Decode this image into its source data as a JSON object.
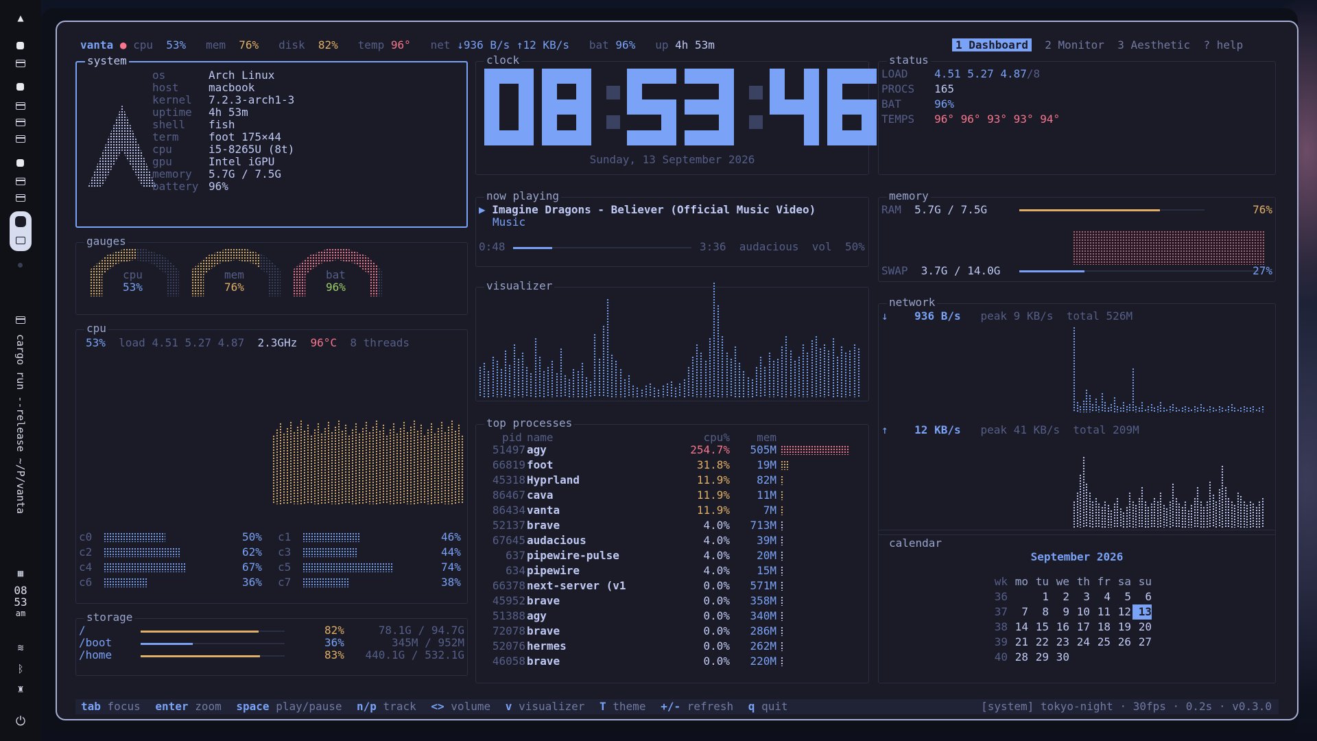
{
  "launcher": {
    "logo": "arch-logo",
    "command": "cargo run --release ~/P/vanta",
    "clock": [
      "08",
      "53",
      "am"
    ]
  },
  "topbar": {
    "host": "vanta",
    "cpu_label": "cpu",
    "cpu": "53%",
    "mem_label": "mem",
    "mem": "76%",
    "disk_label": "disk",
    "disk": "82%",
    "temp_label": "temp",
    "temp": "96°",
    "net_label": "net",
    "net": "↓936 B/s ↑12 KB/s",
    "bat_label": "bat",
    "bat": "96%",
    "up_label": "up",
    "up": "4h 53m",
    "tabs": [
      "1 Dashboard",
      "2 Monitor",
      "3 Aesthetic",
      "? help"
    ]
  },
  "system": {
    "title": "system",
    "rows": [
      [
        "os",
        "Arch Linux"
      ],
      [
        "host",
        "macbook"
      ],
      [
        "kernel",
        "7.2.3-arch1-3"
      ],
      [
        "uptime",
        "4h 53m"
      ],
      [
        "shell",
        "fish"
      ],
      [
        "term",
        "foot 175×44"
      ],
      [
        "cpu",
        "i5-8265U (8t)"
      ],
      [
        "gpu",
        "Intel iGPU"
      ],
      [
        "memory",
        "5.7G / 7.5G"
      ],
      [
        "battery",
        "96%"
      ]
    ]
  },
  "gauges": {
    "title": "gauges",
    "items": [
      {
        "label": "cpu",
        "value": "53%",
        "pct": 0.53,
        "color": "#e0af68"
      },
      {
        "label": "mem",
        "value": "76%",
        "pct": 0.76,
        "color": "#e0af68"
      },
      {
        "label": "bat",
        "value": "96%",
        "pct": 0.96,
        "color": "#f7768e"
      }
    ]
  },
  "cpu": {
    "title": "cpu",
    "pct": "53%",
    "load": "load 4.51 5.27 4.87",
    "freq": "2.3GHz",
    "temp": "96°C",
    "threads": "8 threads",
    "cores": [
      {
        "name": "c0",
        "value": "50%",
        "pct": 0.5
      },
      {
        "name": "c1",
        "value": "46%",
        "pct": 0.46
      },
      {
        "name": "c2",
        "value": "62%",
        "pct": 0.62
      },
      {
        "name": "c3",
        "value": "44%",
        "pct": 0.44
      },
      {
        "name": "c4",
        "value": "67%",
        "pct": 0.67
      },
      {
        "name": "c5",
        "value": "74%",
        "pct": 0.74
      },
      {
        "name": "c6",
        "value": "36%",
        "pct": 0.36
      },
      {
        "name": "c7",
        "value": "38%",
        "pct": 0.38
      }
    ]
  },
  "storage": {
    "title": "storage",
    "rows": [
      {
        "mount": "/",
        "pct": 0.82,
        "value": "82%",
        "size": "78.1G / 94.7G",
        "color": "#e0af68"
      },
      {
        "mount": "/boot",
        "pct": 0.36,
        "value": "36%",
        "size": "345M / 952M",
        "color": "#7aa2f7"
      },
      {
        "mount": "/home",
        "pct": 0.83,
        "value": "83%",
        "size": "440.1G / 532.1G",
        "color": "#e0af68"
      }
    ]
  },
  "clock": {
    "title": "clock",
    "time": "08:53:46",
    "date": "Sunday, 13 September 2026"
  },
  "nowplaying": {
    "title": "now playing",
    "track": "Imagine Dragons - Believer (Official Music Video)",
    "album": "Music",
    "elapsed": "0:48",
    "duration": "3:36",
    "progress": 0.22,
    "player": "audacious",
    "vol_label": "vol",
    "vol": "50%"
  },
  "visualizer": {
    "title": "visualizer"
  },
  "procs": {
    "title": "top processes",
    "headers": [
      "pid",
      "name",
      "cpu%",
      "mem"
    ],
    "rows": [
      [
        "51497",
        "agy",
        "254.7%",
        "505M"
      ],
      [
        "66819",
        "foot",
        "31.8%",
        "19M"
      ],
      [
        "45318",
        "Hyprland",
        "11.9%",
        "82M"
      ],
      [
        "86467",
        "cava",
        "11.9%",
        "11M"
      ],
      [
        "86434",
        "vanta",
        "11.9%",
        "7M"
      ],
      [
        "52137",
        "brave",
        "4.0%",
        "713M"
      ],
      [
        "67645",
        "audacious",
        "4.0%",
        "39M"
      ],
      [
        "637",
        "pipewire-pulse",
        "4.0%",
        "20M"
      ],
      [
        "634",
        "pipewire",
        "4.0%",
        "15M"
      ],
      [
        "66378",
        "next-server (v1",
        "0.0%",
        "571M"
      ],
      [
        "45952",
        "brave",
        "0.0%",
        "358M"
      ],
      [
        "51388",
        "agy",
        "0.0%",
        "340M"
      ],
      [
        "72078",
        "brave",
        "0.0%",
        "286M"
      ],
      [
        "52076",
        "hermes",
        "0.0%",
        "262M"
      ],
      [
        "46058",
        "brave",
        "0.0%",
        "220M"
      ]
    ]
  },
  "status": {
    "title": "status",
    "load_label": "LOAD",
    "load": "4.51 5.27 4.87",
    "load_of": "/8",
    "procs_label": "PROCS",
    "procs": "165",
    "bat_label": "BAT",
    "bat": "96%",
    "temps_label": "TEMPS",
    "temps": "96° 96° 93° 93° 94°"
  },
  "memory": {
    "title": "memory",
    "ram_label": "RAM",
    "ram": "5.7G / 7.5G",
    "ram_pct": "76%",
    "ram_frac": 0.76,
    "swap_label": "SWAP",
    "swap": "3.7G / 14.0G",
    "swap_pct": "27%",
    "swap_frac": 0.27
  },
  "network": {
    "title": "network",
    "down_arrow": "↓",
    "down": "936 B/s",
    "down_peak": "peak 9 KB/s",
    "down_total": "total 526M",
    "up_arrow": "↑",
    "up": "12 KB/s",
    "up_peak": "peak 41 KB/s",
    "up_total": "total 209M"
  },
  "calendar": {
    "title": "calendar",
    "month": "September 2026",
    "headers": [
      "wk",
      "mo",
      "tu",
      "we",
      "th",
      "fr",
      "sa",
      "su"
    ],
    "weeks": [
      [
        "36",
        "",
        "1",
        "2",
        "3",
        "4",
        "5",
        "6"
      ],
      [
        "37",
        "7",
        "8",
        "9",
        "10",
        "11",
        "12",
        "13"
      ],
      [
        "38",
        "14",
        "15",
        "16",
        "17",
        "18",
        "19",
        "20"
      ],
      [
        "39",
        "21",
        "22",
        "23",
        "24",
        "25",
        "26",
        "27"
      ],
      [
        "40",
        "28",
        "29",
        "30",
        "",
        "",
        "",
        ""
      ]
    ],
    "today": "13"
  },
  "footer": {
    "keys": [
      [
        "tab",
        "focus"
      ],
      [
        "enter",
        "zoom"
      ],
      [
        "space",
        "play/pause"
      ],
      [
        "n/p",
        "track"
      ],
      [
        "<>",
        "volume"
      ],
      [
        "v",
        "visualizer"
      ],
      [
        "T",
        "theme"
      ],
      [
        "+/-",
        "refresh"
      ],
      [
        "q",
        "quit"
      ]
    ],
    "right": "[system] tokyo-night · 30fps · 0.2s · v0.3.0"
  }
}
